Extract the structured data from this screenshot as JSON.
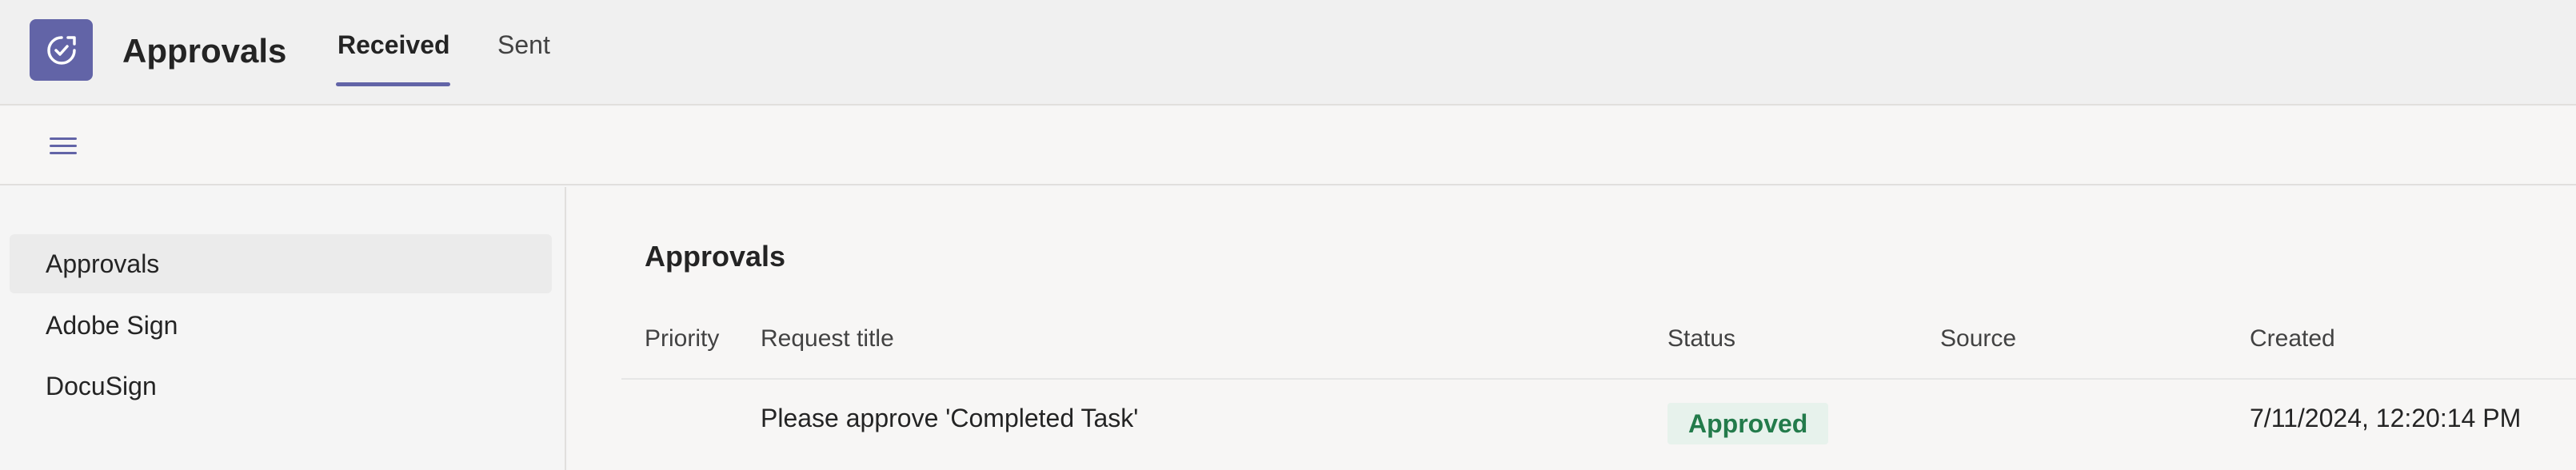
{
  "header": {
    "app_title": "Approvals",
    "tabs": [
      {
        "label": "Received",
        "active": true
      },
      {
        "label": "Sent",
        "active": false
      }
    ],
    "accent_color": "#6264a7",
    "app_icon": "approvals-check-icon"
  },
  "toolbar": {
    "menu_icon": "hamburger-icon"
  },
  "sidebar": {
    "items": [
      {
        "label": "Approvals",
        "active": true
      },
      {
        "label": "Adobe Sign",
        "active": false
      },
      {
        "label": "DocuSign",
        "active": false
      }
    ]
  },
  "main": {
    "title": "Approvals",
    "columns": [
      "Priority",
      "Request title",
      "Status",
      "Source",
      "Created"
    ],
    "rows": [
      {
        "priority": "",
        "request_title": "Please approve 'Completed Task'",
        "status": "Approved",
        "source": "",
        "created": "7/11/2024, 12:20:14 PM"
      }
    ],
    "status_colors": {
      "approved_bg": "#e7f2ec",
      "approved_text": "#237b4b"
    }
  }
}
